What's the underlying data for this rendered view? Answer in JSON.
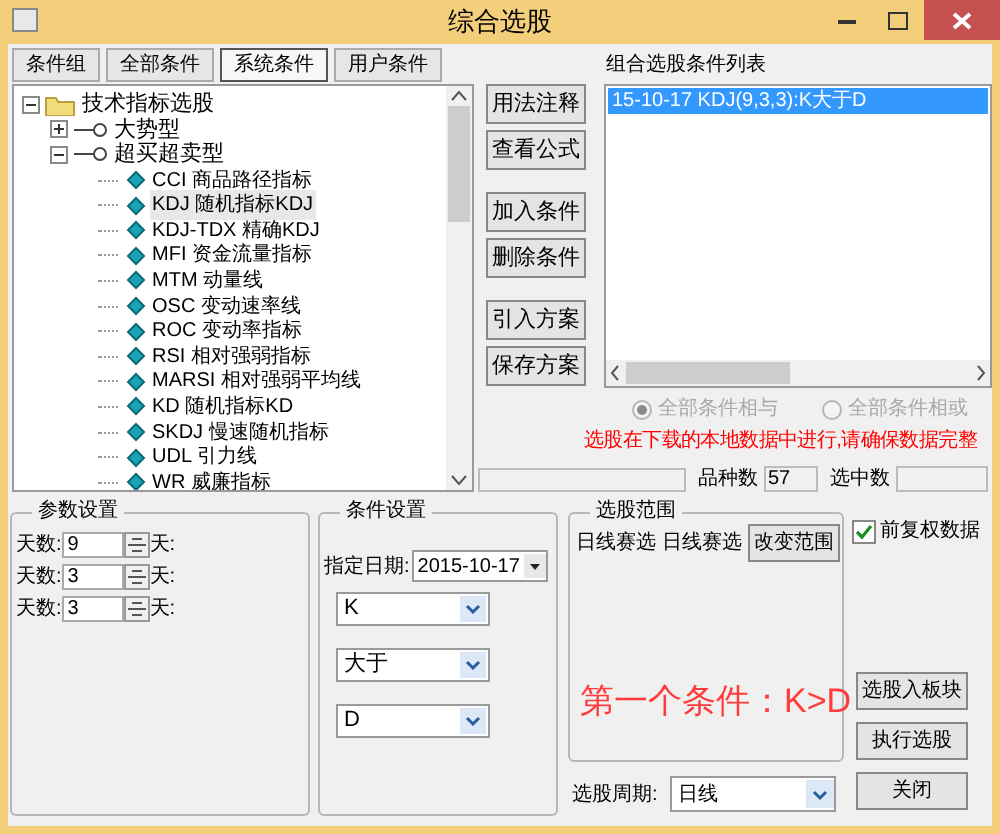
{
  "window": {
    "title": "综合选股"
  },
  "tabs": [
    {
      "label": "条件组",
      "selected": false
    },
    {
      "label": "全部条件",
      "selected": false
    },
    {
      "label": "系统条件",
      "selected": true
    },
    {
      "label": "用户条件",
      "selected": false
    }
  ],
  "tree": [
    {
      "label": "技术指标选股",
      "kind": "folder",
      "expanded": true,
      "selected": false,
      "children": [
        {
          "label": "大势型",
          "kind": "group",
          "expanded": false,
          "selected": false
        },
        {
          "label": "超买超卖型",
          "kind": "group",
          "expanded": true,
          "selected": false,
          "children": [
            {
              "label": "CCI 商品路径指标",
              "kind": "indicator",
              "selected": false
            },
            {
              "label": "KDJ 随机指标KDJ",
              "kind": "indicator",
              "selected": true
            },
            {
              "label": "KDJ-TDX 精确KDJ",
              "kind": "indicator",
              "selected": false
            },
            {
              "label": "MFI 资金流量指标",
              "kind": "indicator",
              "selected": false
            },
            {
              "label": "MTM 动量线",
              "kind": "indicator",
              "selected": false
            },
            {
              "label": "OSC 变动速率线",
              "kind": "indicator",
              "selected": false
            },
            {
              "label": "ROC 变动率指标",
              "kind": "indicator",
              "selected": false
            },
            {
              "label": "RSI 相对强弱指标",
              "kind": "indicator",
              "selected": false
            },
            {
              "label": "MARSI 相对强弱平均线",
              "kind": "indicator",
              "selected": false
            },
            {
              "label": "KD 随机指标KD",
              "kind": "indicator",
              "selected": false
            },
            {
              "label": "SKDJ 慢速随机指标",
              "kind": "indicator",
              "selected": false
            },
            {
              "label": "UDL 引力线",
              "kind": "indicator",
              "selected": false
            },
            {
              "label": "WR 威廉指标",
              "kind": "indicator",
              "selected": false
            }
          ]
        }
      ]
    }
  ],
  "side_buttons": [
    [
      "用法注释",
      "查看公式"
    ],
    [
      "加入条件",
      "删除条件"
    ],
    [
      "引入方案",
      "保存方案"
    ]
  ],
  "condition_list": {
    "label": "组合选股条件列表",
    "items": [
      {
        "text": "15-10-17 KDJ(9,3,3):K大于D",
        "selected": true
      }
    ]
  },
  "logic": {
    "disabled": true,
    "options": [
      {
        "label": "全部条件相与",
        "selected": true
      },
      {
        "label": "全部条件相或",
        "selected": false
      }
    ]
  },
  "notice": "选股在下载的本地数据中进行,请确保数据完整",
  "status": {
    "level": 0,
    "count_label": "品种数",
    "count": "57",
    "selected_label": "选中数"
  },
  "params": {
    "title": "参数设置",
    "rows": [
      {
        "label": "天数:",
        "value": "9",
        "unit": "天:"
      },
      {
        "label": "天数:",
        "value": "3",
        "unit": "天:"
      },
      {
        "label": "天数:",
        "value": "3",
        "unit": "天:"
      }
    ]
  },
  "conditions": {
    "title": "条件设置",
    "date_label": "指定日期:",
    "date": "2015-10-17",
    "selects": [
      "K",
      "大于",
      "D"
    ]
  },
  "scope": {
    "title": "选股范围",
    "texts": [
      "日线赛选",
      "日线赛选"
    ],
    "button": "改变范围",
    "period_label": "选股周期:",
    "period": "日线"
  },
  "adjust": {
    "label": "前复权数据",
    "checked": true
  },
  "action_buttons": [
    "选股入板块",
    "执行选股",
    "关闭"
  ],
  "annotation": "第一个条件：K>D"
}
